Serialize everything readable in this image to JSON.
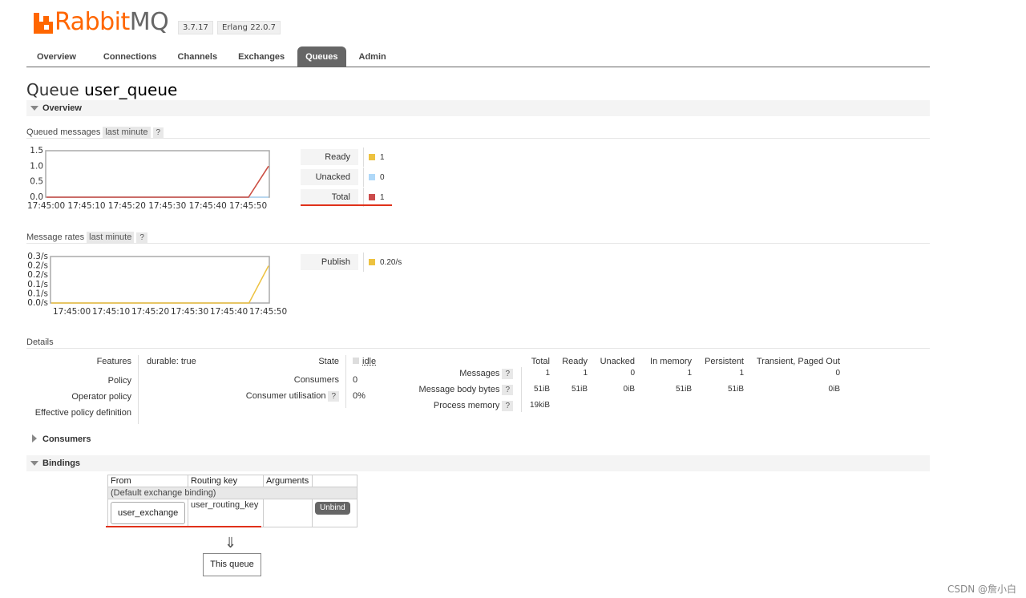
{
  "header": {
    "logo": {
      "rabbit": "Rabbit",
      "mq": "MQ"
    },
    "version": "3.7.17",
    "erlang": "Erlang 22.0.7",
    "tabs": [
      {
        "label": "Overview",
        "active": false
      },
      {
        "label": "Connections",
        "active": false
      },
      {
        "label": "Channels",
        "active": false
      },
      {
        "label": "Exchanges",
        "active": false
      },
      {
        "label": "Queues",
        "active": true
      },
      {
        "label": "Admin",
        "active": false
      }
    ]
  },
  "page": {
    "title_prefix": "Queue",
    "queue_name": "user_queue"
  },
  "overview": {
    "section_label": "Overview",
    "queued": {
      "label": "Queued messages",
      "range": "last minute",
      "help": "?",
      "legend": [
        {
          "label": "Ready",
          "value": "1",
          "color": "#edc240"
        },
        {
          "label": "Unacked",
          "value": "0",
          "color": "#afd8f8"
        },
        {
          "label": "Total",
          "value": "1",
          "color": "#cb4b4b"
        }
      ]
    },
    "rates": {
      "label": "Message rates",
      "range": "last minute",
      "help": "?",
      "legend": [
        {
          "label": "Publish",
          "value": "0.20/s",
          "color": "#edc240"
        }
      ]
    }
  },
  "chart_data": [
    {
      "type": "line",
      "title": "",
      "x": [
        "17:45:00",
        "17:45:10",
        "17:45:20",
        "17:45:30",
        "17:45:40",
        "17:45:50"
      ],
      "y_ticks": [
        "0.0",
        "0.5",
        "1.0",
        "1.5"
      ],
      "ylim": [
        0,
        1.5
      ],
      "series": [
        {
          "name": "Ready",
          "color": "#edc240",
          "values": [
            0,
            0,
            0,
            0,
            0,
            1
          ]
        },
        {
          "name": "Unacked",
          "color": "#afd8f8",
          "values": [
            0,
            0,
            0,
            0,
            0,
            0
          ]
        },
        {
          "name": "Total",
          "color": "#cb4b4b",
          "values": [
            0,
            0,
            0,
            0,
            0,
            1
          ]
        }
      ]
    },
    {
      "type": "line",
      "title": "",
      "x": [
        "17:45:00",
        "17:45:10",
        "17:45:20",
        "17:45:30",
        "17:45:40",
        "17:45:50"
      ],
      "y_ticks": [
        "0.0/s",
        "0.1/s",
        "0.1/s",
        "0.2/s",
        "0.2/s",
        "0.3/s"
      ],
      "ylim": [
        0,
        0.25
      ],
      "series": [
        {
          "name": "Publish",
          "color": "#edc240",
          "values": [
            0,
            0,
            0,
            0,
            0,
            0.2
          ]
        }
      ]
    }
  ],
  "details": {
    "label": "Details",
    "left": [
      {
        "label": "Features",
        "value_key": "durable:",
        "value": "true"
      },
      {
        "label": "Policy",
        "value_key": "",
        "value": ""
      },
      {
        "label": "Operator policy",
        "value_key": "",
        "value": ""
      },
      {
        "label": "Effective policy definition",
        "value_key": "",
        "value": ""
      }
    ],
    "mid": [
      {
        "label": "State",
        "value": "idle"
      },
      {
        "label": "Consumers",
        "value": "0"
      },
      {
        "label": "Consumer utilisation",
        "value": "0%",
        "help": "?"
      }
    ],
    "stats": {
      "headers": [
        "Total",
        "Ready",
        "Unacked",
        "In memory",
        "Persistent",
        "Transient, Paged Out"
      ],
      "rows": [
        {
          "label": "Messages",
          "help": "?",
          "values": [
            "1",
            "1",
            "0",
            "1",
            "1",
            "0"
          ]
        },
        {
          "label": "Message body bytes",
          "help": "?",
          "values": [
            "51iB",
            "51iB",
            "0iB",
            "51iB",
            "51iB",
            "0iB"
          ]
        },
        {
          "label": "Process memory",
          "help": "?",
          "values": [
            "19kiB",
            "",
            "",
            "",
            "",
            ""
          ]
        }
      ]
    }
  },
  "consumers": {
    "label": "Consumers"
  },
  "bindings": {
    "label": "Bindings",
    "headers": [
      "From",
      "Routing key",
      "Arguments"
    ],
    "default_row": "(Default exchange binding)",
    "row": {
      "from": "user_exchange",
      "routing_key": "user_routing_key",
      "action": "Unbind"
    },
    "arrow": "⇓",
    "this_queue": "This queue"
  },
  "watermark": "CSDN @詹小白"
}
